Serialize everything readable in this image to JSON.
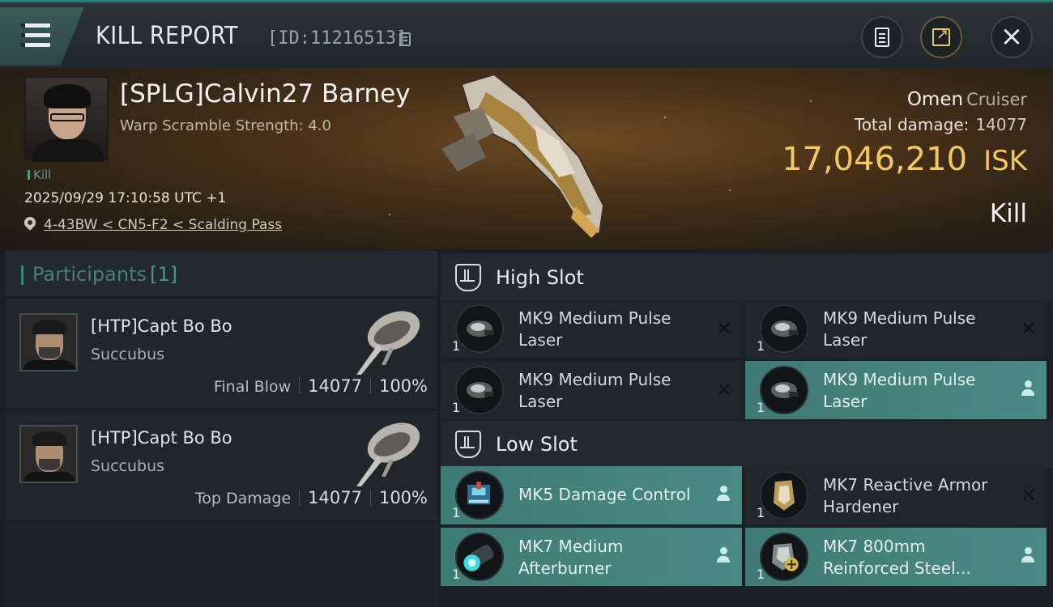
{
  "header": {
    "title": "KILL REPORT",
    "report_id": "[ID:11216513]"
  },
  "victim": {
    "pilot": "[SPLG]Calvin27 Barney",
    "warp_scramble": "Warp Scramble Strength: 4.0",
    "tag": "Kill",
    "datetime": "2025/09/29 17:10:58 UTC +1",
    "location": "4-43BW < CN5-F2 < Scalding Pass",
    "ship": "Omen",
    "ship_class": "Cruiser",
    "total_damage_label": "Total damage:",
    "total_damage": "14077",
    "isk_value": "17,046,210",
    "isk_unit": "ISK",
    "result": "Kill"
  },
  "participants": {
    "label": "Participants",
    "count": "[1]",
    "rows": [
      {
        "name": "[HTP]Capt Bo Bo",
        "ship": "Succubus",
        "role": "Final Blow",
        "damage": "14077",
        "percent": "100%"
      },
      {
        "name": "[HTP]Capt Bo Bo",
        "ship": "Succubus",
        "role": "Top Damage",
        "damage": "14077",
        "percent": "100%"
      }
    ]
  },
  "slots": {
    "high": {
      "label": "High Slot",
      "items": [
        {
          "name": "MK9 Medium Pulse Laser",
          "qty": "1",
          "state": "destroyed",
          "icon": "pulse-laser-icon"
        },
        {
          "name": "MK9 Medium Pulse Laser",
          "qty": "1",
          "state": "destroyed",
          "icon": "pulse-laser-icon"
        },
        {
          "name": "MK9 Medium Pulse Laser",
          "qty": "1",
          "state": "destroyed",
          "icon": "pulse-laser-icon"
        },
        {
          "name": "MK9 Medium Pulse Laser",
          "qty": "1",
          "state": "dropped",
          "icon": "pulse-laser-icon"
        }
      ]
    },
    "low": {
      "label": "Low Slot",
      "items": [
        {
          "name": "MK5 Damage Control",
          "qty": "1",
          "state": "dropped",
          "icon": "damage-control-icon"
        },
        {
          "name": "MK7 Reactive Armor Hardener",
          "qty": "1",
          "state": "destroyed",
          "icon": "armor-hardener-icon"
        },
        {
          "name": "MK7 Medium Afterburner",
          "qty": "1",
          "state": "dropped",
          "icon": "afterburner-icon"
        },
        {
          "name": "MK7 800mm Reinforced Steel...",
          "qty": "1",
          "state": "dropped",
          "icon": "armor-plate-icon"
        }
      ]
    }
  },
  "colors": {
    "accent_teal": "#2e7a74",
    "isk_gold": "#f4c766",
    "selected_row": "#4a8a84"
  }
}
